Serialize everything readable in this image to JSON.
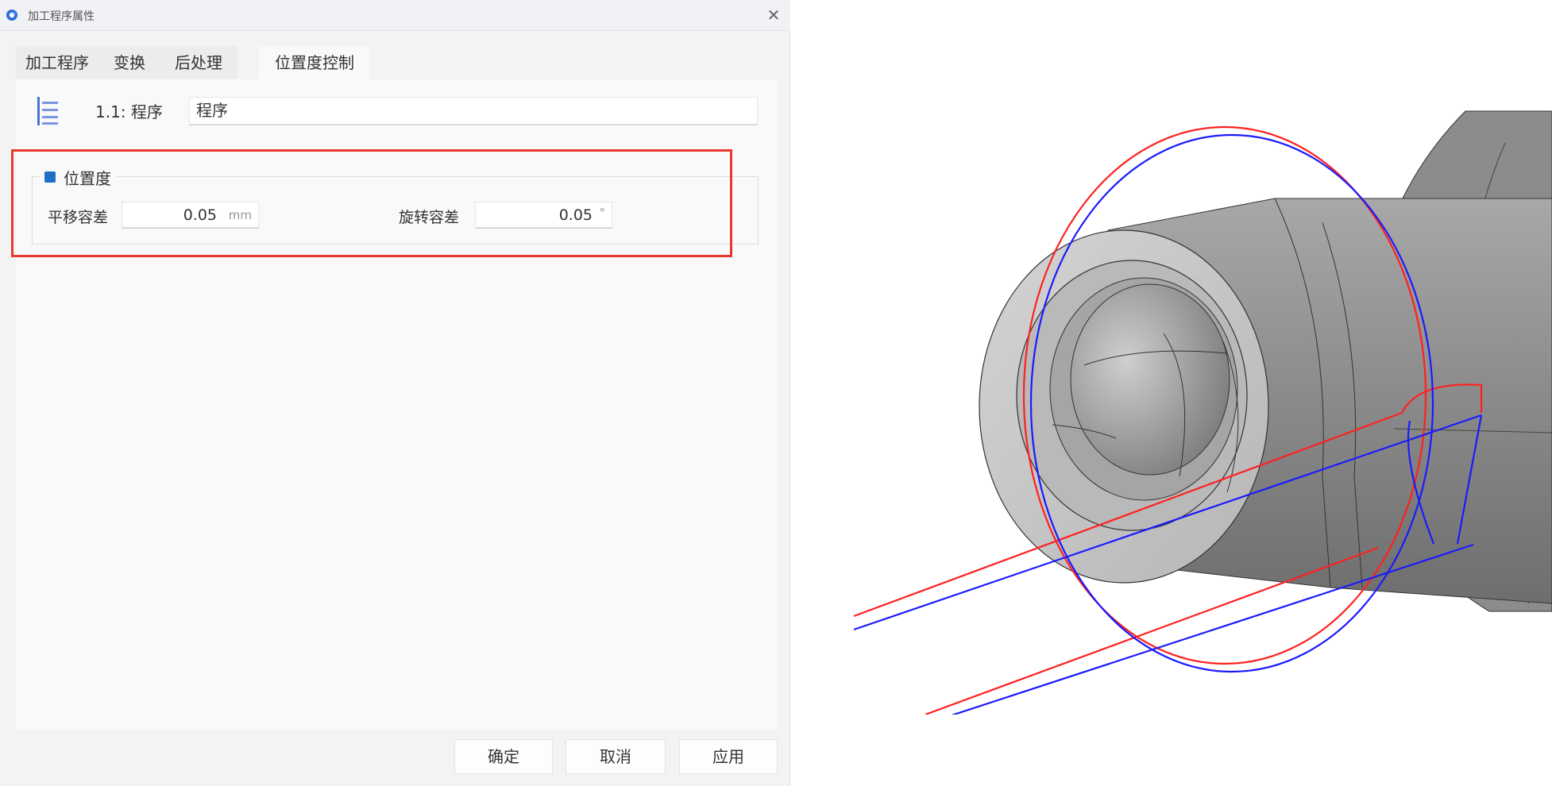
{
  "dialog": {
    "title": "加工程序属性",
    "close_symbol": "✕",
    "tabs": [
      {
        "label": "加工程序",
        "active": false
      },
      {
        "label": "变换",
        "active": false
      },
      {
        "label": "后处理",
        "active": false
      },
      {
        "label": "位置度控制",
        "active": true
      }
    ],
    "program": {
      "icon": "program-list-icon",
      "label": "1.1: 程序",
      "name_value": "程序"
    },
    "position_group": {
      "checkbox_checked": true,
      "title": "位置度",
      "translation": {
        "label": "平移容差",
        "value": "0.05",
        "unit": "mm"
      },
      "rotation": {
        "label": "旋转容差",
        "value": "0.05",
        "unit": "°"
      }
    },
    "buttons": {
      "ok": "确定",
      "cancel": "取消",
      "apply": "应用"
    }
  },
  "colors": {
    "highlight": "#e8382f",
    "checkbox": "#1f6fc9",
    "path_red": "#ff2020",
    "path_blue": "#1a1aff",
    "part_gray": "#9a9a9a"
  }
}
